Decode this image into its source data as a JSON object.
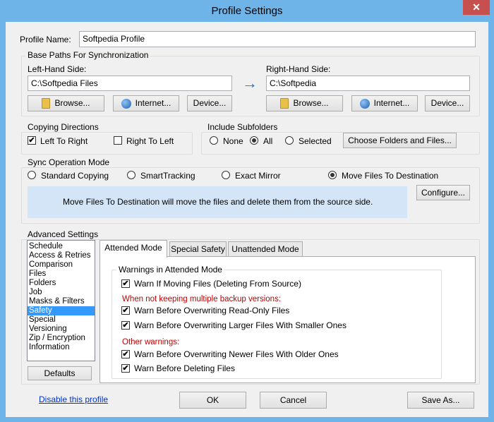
{
  "window": {
    "title": "Profile Settings",
    "close_glyph": "✕"
  },
  "profile": {
    "label": "Profile Name:",
    "value": "Softpedia Profile"
  },
  "base_paths": {
    "label": "Base Paths For Synchronization",
    "left": {
      "label": "Left-Hand Side:",
      "path": "C:\\Softpedia Files"
    },
    "right": {
      "label": "Right-Hand Side:",
      "path": "C:\\Softpedia"
    },
    "arrow_glyph": "→",
    "browse_label": "Browse...",
    "internet_label": "Internet...",
    "device_label": "Device..."
  },
  "copying_directions": {
    "label": "Copying Directions",
    "left_to_right": {
      "label": "Left To Right",
      "checked": true
    },
    "right_to_left": {
      "label": "Right To Left",
      "checked": false
    }
  },
  "include_subfolders": {
    "label": "Include Subfolders",
    "options": [
      "None",
      "All",
      "Selected"
    ],
    "selected": "All",
    "choose_label": "Choose Folders and Files..."
  },
  "sync_mode": {
    "label": "Sync Operation Mode",
    "options": [
      "Standard Copying",
      "SmartTracking",
      "Exact Mirror",
      "Move Files To Destination"
    ],
    "selected": "Move Files To Destination",
    "description": "Move Files To Destination will move the files and delete them from the source side.",
    "configure_label": "Configure..."
  },
  "advanced": {
    "label": "Advanced Settings",
    "categories": [
      "Schedule",
      "Access & Retries",
      "Comparison",
      "Files",
      "Folders",
      "Job",
      "Masks & Filters",
      "Safety",
      "Special",
      "Versioning",
      "Zip / Encryption",
      "Information"
    ],
    "selected_category": "Safety",
    "defaults_label": "Defaults",
    "tabs": [
      "Attended Mode",
      "Special Safety",
      "Unattended Mode"
    ],
    "active_tab": "Attended Mode",
    "warnings_group_label": "Warnings in Attended Mode",
    "warn_moving": "Warn If Moving Files (Deleting From Source)",
    "backup_note": "When not keeping multiple backup versions:",
    "warn_readonly": "Warn Before Overwriting Read-Only Files",
    "warn_larger": "Warn Before Overwriting Larger Files With Smaller Ones",
    "other_note": "Other warnings:",
    "warn_newer": "Warn Before Overwriting Newer Files With Older Ones",
    "warn_deleting": "Warn Before Deleting Files",
    "check_glyph": "✔"
  },
  "footer": {
    "disable_link": "Disable this profile",
    "ok_label": "OK",
    "cancel_label": "Cancel",
    "save_as_label": "Save As..."
  },
  "colors": {
    "titlebar": "#6fb4e8",
    "close": "#c7504f",
    "selection": "#3399ff",
    "info_panel": "#d4e5f8",
    "warning_text": "#c00000"
  }
}
